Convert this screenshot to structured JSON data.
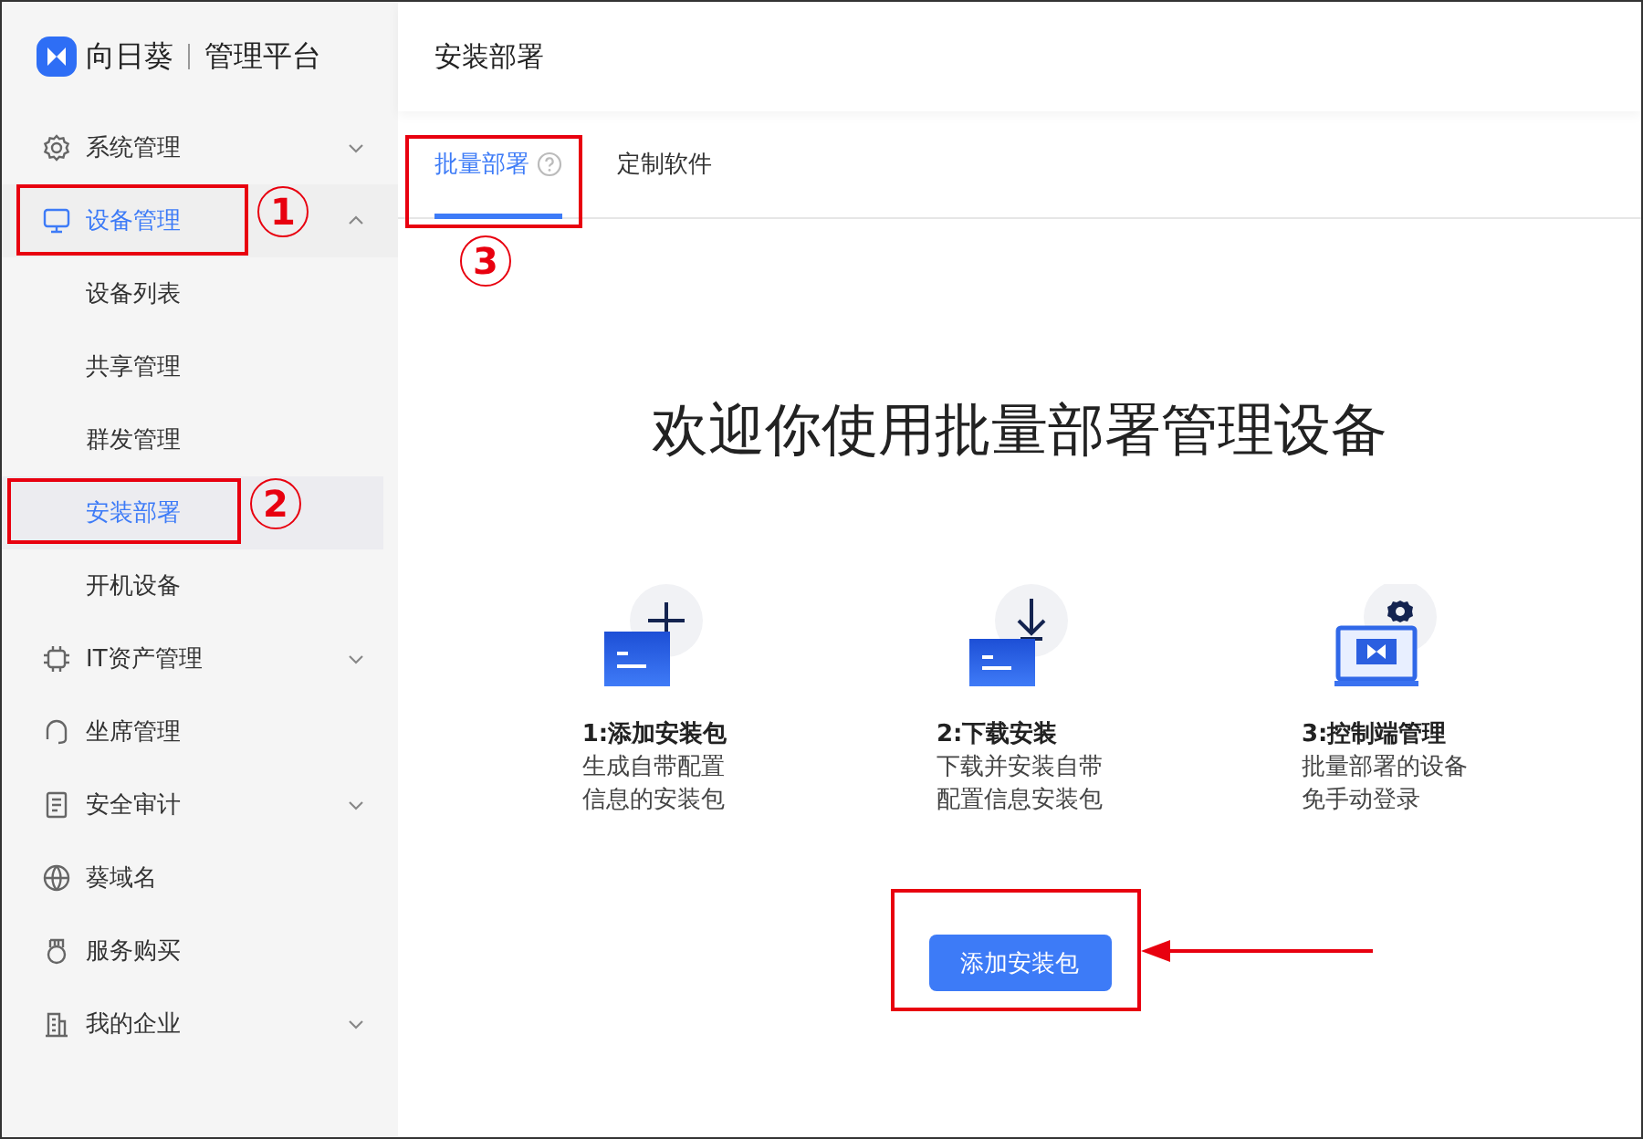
{
  "brand": {
    "name": "向日葵",
    "product": "管理平台"
  },
  "sidebar": {
    "items": [
      {
        "label": "系统管理",
        "expanded": false,
        "selected": false
      },
      {
        "label": "设备管理",
        "expanded": true,
        "children": [
          {
            "label": "设备列表",
            "selected": false
          },
          {
            "label": "共享管理",
            "selected": false
          },
          {
            "label": "群发管理",
            "selected": false
          },
          {
            "label": "安装部署",
            "selected": true
          },
          {
            "label": "开机设备",
            "selected": false
          }
        ]
      },
      {
        "label": "IT资产管理",
        "expanded": false,
        "selected": false
      },
      {
        "label": "坐席管理",
        "selected": false
      },
      {
        "label": "安全审计",
        "expanded": false,
        "selected": false
      },
      {
        "label": "葵域名",
        "selected": false
      },
      {
        "label": "服务购买",
        "selected": false
      },
      {
        "label": "我的企业",
        "expanded": false,
        "selected": false
      }
    ]
  },
  "header": {
    "title": "安装部署"
  },
  "tabs": [
    {
      "label": "批量部署",
      "selected": true,
      "help": true
    },
    {
      "label": "定制软件",
      "selected": false
    }
  ],
  "welcome": {
    "heading": "欢迎你使用批量部署管理设备",
    "steps": [
      {
        "title": "1:添加安装包",
        "description": [
          "生成自带配置",
          "信息的安装包"
        ]
      },
      {
        "title": "2:下载安装",
        "description": [
          "下载并安装自带",
          "配置信息安装包"
        ]
      },
      {
        "title": "3:控制端管理",
        "description": [
          "批量部署的设备",
          "免手动登录"
        ]
      }
    ],
    "button": "添加安装包"
  },
  "annotations": {
    "markers": [
      "1",
      "2",
      "3"
    ]
  }
}
